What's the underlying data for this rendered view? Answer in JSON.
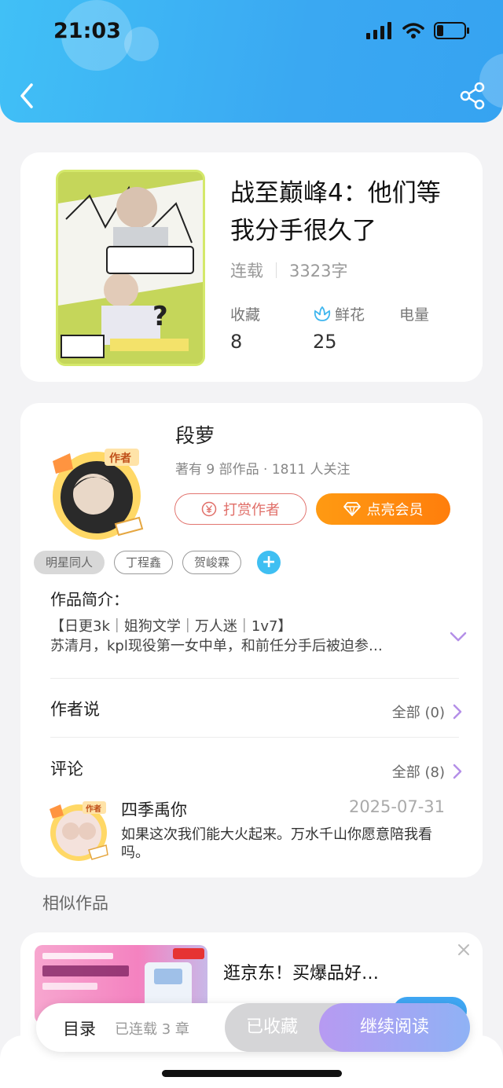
{
  "status_bar": {
    "time": "21:03"
  },
  "book": {
    "title": "战至巅峰4：他们等我分手很久了",
    "status": "连载",
    "word_count": "3323字",
    "stats": [
      {
        "label": "收藏",
        "value": "8"
      },
      {
        "label": "鲜花",
        "value": "25",
        "icon": "flower-icon"
      },
      {
        "label": "电量",
        "value": ""
      }
    ]
  },
  "author": {
    "name": "段萝",
    "meta": "著有 9 部作品 · 1811 人关注",
    "badge": "作者",
    "tip_label": "打赏作者",
    "vip_label": "点亮会员",
    "tags": [
      "明星同人",
      "丁程鑫",
      "贺峻霖"
    ],
    "intro_label": "作品简介：",
    "intro_lines": [
      "【日更3k｜姐狗文学｜万人迷｜1v7】",
      "苏清月，kpl现役第一女中单，和前任分手后被迫参…"
    ],
    "author_says_label": "作者说",
    "author_says_more": "全部 (0)",
    "comments_label": "评论",
    "comments_more": "全部 (8)"
  },
  "comment": {
    "user": "四季禹你",
    "badge": "作者",
    "date": "2025-07-31",
    "text": "如果这次我们能大火起来。万水千山你愿意陪我看吗。"
  },
  "similar_label": "相似作品",
  "ad": {
    "title": "逛京东！买爆品好…"
  },
  "action_bar": {
    "toc_label": "目录",
    "toc_count": "已连载 3 章",
    "collected_label": "已收藏",
    "read_label": "继续阅读"
  },
  "colors": {
    "header": "#3aa8f2",
    "vip": "#ff8a10",
    "tip": "#e06e68",
    "accent_purple": "#b79af2"
  }
}
